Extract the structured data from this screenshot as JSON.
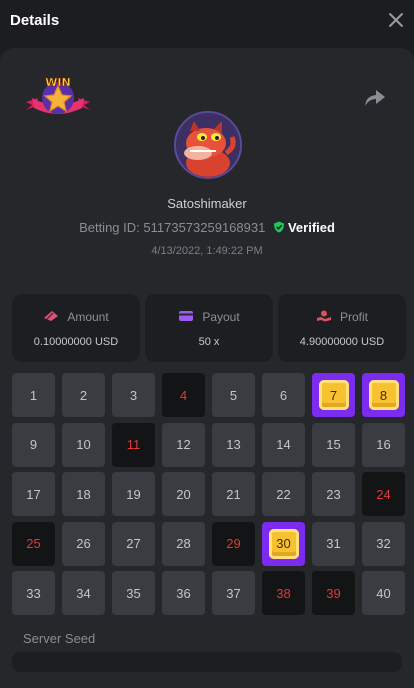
{
  "header": {
    "title": "Details"
  },
  "user": {
    "username": "Satoshimaker",
    "betting_id_label": "Betting ID:",
    "betting_id": "51173573259168931",
    "verified_label": "Verified",
    "date": "4/13/2022, 1:49:22 PM"
  },
  "badge": {
    "text": "WIN"
  },
  "stats": {
    "amount": {
      "label": "Amount",
      "value": "0.10000000 USD"
    },
    "payout": {
      "label": "Payout",
      "value": "50 x"
    },
    "profit": {
      "label": "Profit",
      "value": "4.90000000 USD"
    }
  },
  "grid": {
    "numbers": [
      1,
      2,
      3,
      4,
      5,
      6,
      7,
      8,
      9,
      10,
      11,
      12,
      13,
      14,
      15,
      16,
      17,
      18,
      19,
      20,
      21,
      22,
      23,
      24,
      25,
      26,
      27,
      28,
      29,
      30,
      31,
      32,
      33,
      34,
      35,
      36,
      37,
      38,
      39,
      40
    ],
    "selected_hits": [
      7,
      8,
      30
    ],
    "selected_misses": [
      4,
      11,
      24,
      25,
      29,
      38,
      39
    ]
  },
  "footer": {
    "server_seed_label": "Server Seed"
  },
  "colors": {
    "accent": "#7b2cf0",
    "miss_text": "#e03a3a",
    "verified": "#22c55e",
    "gem": "#f6c232"
  }
}
